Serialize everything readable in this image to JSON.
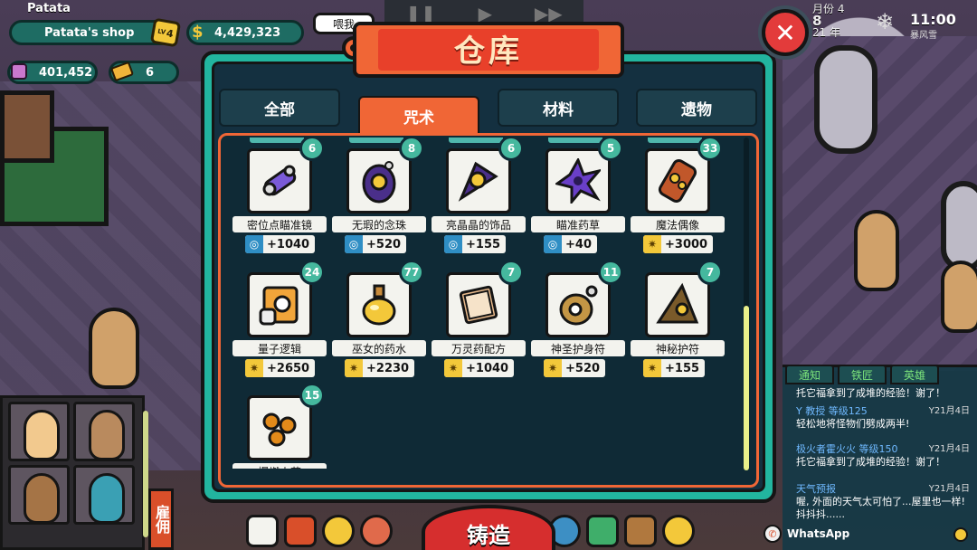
{
  "hud": {
    "player_name": "Patata",
    "shop_name": "Patata's shop",
    "level": "4",
    "level_prefix": "LV",
    "money_symbol": "$",
    "money": "4,429,323",
    "gems": "401,452",
    "tickets": "6",
    "speech": "喂我",
    "date_month": "月份 4",
    "date_day": "8",
    "date_year": "21 年",
    "time": "11:00",
    "weather": "暴风雪"
  },
  "dialog": {
    "title": "仓库",
    "close_label": "✕",
    "tabs": [
      {
        "label": "全部",
        "active": false
      },
      {
        "label": "咒术",
        "active": true
      },
      {
        "label": "材料",
        "active": false
      },
      {
        "label": "遗物",
        "active": false
      }
    ],
    "items": [
      {
        "name": "密位点瞄准镜",
        "count": "6",
        "stat": "+1040",
        "stat_type": "blue",
        "icon": "scope-icon"
      },
      {
        "name": "无瑕的念珠",
        "count": "8",
        "stat": "+520",
        "stat_type": "blue",
        "icon": "rosary-icon"
      },
      {
        "name": "亮晶晶的饰品",
        "count": "6",
        "stat": "+155",
        "stat_type": "blue",
        "icon": "trinket-icon"
      },
      {
        "name": "瞄准药草",
        "count": "5",
        "stat": "+40",
        "stat_type": "blue",
        "icon": "herb-icon"
      },
      {
        "name": "魔法偶像",
        "count": "33",
        "stat": "+3000",
        "stat_type": "gold",
        "icon": "idol-icon"
      },
      {
        "name": "量子逻辑",
        "count": "24",
        "stat": "+2650",
        "stat_type": "gold",
        "icon": "scroll-icon"
      },
      {
        "name": "巫女的药水",
        "count": "77",
        "stat": "+2230",
        "stat_type": "gold",
        "icon": "potion-icon"
      },
      {
        "name": "万灵药配方",
        "count": "7",
        "stat": "+1040",
        "stat_type": "gold",
        "icon": "book-icon"
      },
      {
        "name": "神圣护身符",
        "count": "11",
        "stat": "+520",
        "stat_type": "gold",
        "icon": "amulet-icon"
      },
      {
        "name": "神秘护符",
        "count": "7",
        "stat": "+155",
        "stat_type": "gold",
        "icon": "talisman-icon"
      },
      {
        "name": "爆燃火花",
        "count": "15",
        "stat": "",
        "stat_type": "gold",
        "icon": "beads-icon"
      }
    ]
  },
  "chat": {
    "tabs": [
      "通知",
      "铁匠",
      "英雄"
    ],
    "messages": [
      {
        "head": "",
        "time": "",
        "body": "托它福拿到了成堆的经验！谢了！"
      },
      {
        "head": "Y 教授 等级125",
        "time": "Y21月4日",
        "body": "轻松地将怪物们劈成两半!"
      },
      {
        "head": "极火者霍火火 等级150",
        "time": "Y21月4日",
        "body": "托它福拿到了成堆的经验！谢了！"
      },
      {
        "head": "天气预报",
        "time": "Y21月4日",
        "body": "喔, 外面的天气太可怕了...屋里也一样! 抖抖抖......"
      }
    ],
    "whatsapp": "WhatsApp"
  },
  "bottom": {
    "forge_label": "铸造",
    "hire_label": "雇佣"
  },
  "colors": {
    "dialog_frame": "#22b59f",
    "dialog_panel": "#143040",
    "accent_orange": "#f06636",
    "badge_teal": "#45b89e",
    "stat_blue": "#2f8ec4",
    "stat_gold": "#f3c83a"
  }
}
